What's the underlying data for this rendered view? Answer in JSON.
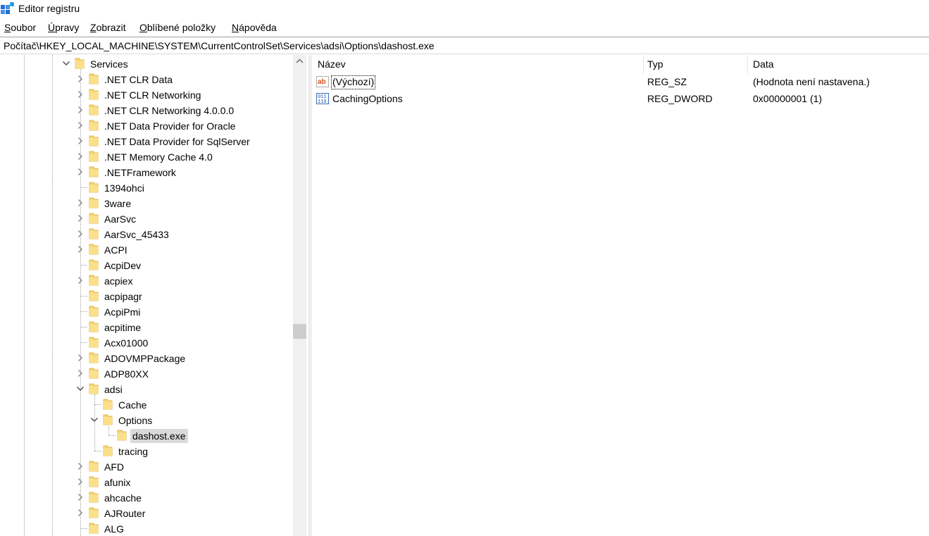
{
  "window": {
    "title": "Editor registru",
    "icon": "registry-editor-icon"
  },
  "menu": [
    {
      "pre": "",
      "u": "S",
      "post": "oubor"
    },
    {
      "pre": "",
      "u": "Ú",
      "post": "pravy"
    },
    {
      "pre": "",
      "u": "Z",
      "post": "obrazit"
    },
    {
      "pre": "",
      "u": "O",
      "post": "blíbené položky"
    },
    {
      "pre": "",
      "u": "N",
      "post": "ápověda"
    }
  ],
  "address": "Počítač\\HKEY_LOCAL_MACHINE\\SYSTEM\\CurrentControlSet\\Services\\adsi\\Options\\dashost.exe",
  "tree": [
    {
      "label": "Services",
      "level": 0,
      "toggle": "expanded"
    },
    {
      "label": ".NET CLR Data",
      "level": 1,
      "toggle": "collapsed"
    },
    {
      "label": ".NET CLR Networking",
      "level": 1,
      "toggle": "collapsed"
    },
    {
      "label": ".NET CLR Networking 4.0.0.0",
      "level": 1,
      "toggle": "collapsed"
    },
    {
      "label": ".NET Data Provider for Oracle",
      "level": 1,
      "toggle": "collapsed"
    },
    {
      "label": ".NET Data Provider for SqlServer",
      "level": 1,
      "toggle": "collapsed"
    },
    {
      "label": ".NET Memory Cache 4.0",
      "level": 1,
      "toggle": "collapsed"
    },
    {
      "label": ".NETFramework",
      "level": 1,
      "toggle": "collapsed"
    },
    {
      "label": "1394ohci",
      "level": 1,
      "toggle": "none"
    },
    {
      "label": "3ware",
      "level": 1,
      "toggle": "collapsed"
    },
    {
      "label": "AarSvc",
      "level": 1,
      "toggle": "collapsed"
    },
    {
      "label": "AarSvc_45433",
      "level": 1,
      "toggle": "collapsed"
    },
    {
      "label": "ACPI",
      "level": 1,
      "toggle": "collapsed"
    },
    {
      "label": "AcpiDev",
      "level": 1,
      "toggle": "none"
    },
    {
      "label": "acpiex",
      "level": 1,
      "toggle": "collapsed"
    },
    {
      "label": "acpipagr",
      "level": 1,
      "toggle": "none"
    },
    {
      "label": "AcpiPmi",
      "level": 1,
      "toggle": "none"
    },
    {
      "label": "acpitime",
      "level": 1,
      "toggle": "none"
    },
    {
      "label": "Acx01000",
      "level": 1,
      "toggle": "none"
    },
    {
      "label": "ADOVMPPackage",
      "level": 1,
      "toggle": "collapsed"
    },
    {
      "label": "ADP80XX",
      "level": 1,
      "toggle": "collapsed"
    },
    {
      "label": "adsi",
      "level": 1,
      "toggle": "expanded"
    },
    {
      "label": "Cache",
      "level": 2,
      "toggle": "none"
    },
    {
      "label": "Options",
      "level": 2,
      "toggle": "expanded"
    },
    {
      "label": "dashost.exe",
      "level": 3,
      "toggle": "none",
      "selected": true
    },
    {
      "label": "tracing",
      "level": 2,
      "toggle": "none"
    },
    {
      "label": "AFD",
      "level": 1,
      "toggle": "collapsed"
    },
    {
      "label": "afunix",
      "level": 1,
      "toggle": "collapsed"
    },
    {
      "label": "ahcache",
      "level": 1,
      "toggle": "collapsed"
    },
    {
      "label": "AJRouter",
      "level": 1,
      "toggle": "collapsed"
    },
    {
      "label": "ALG",
      "level": 1,
      "toggle": "none"
    }
  ],
  "list": {
    "columns": [
      "Název",
      "Typ",
      "Data"
    ],
    "rows": [
      {
        "name": "(Výchozí)",
        "type": "REG_SZ",
        "data": "(Hodnota není nastavena.)",
        "icon": "string-value-icon"
      },
      {
        "name": "CachingOptions",
        "type": "REG_DWORD",
        "data": "0x00000001 (1)",
        "icon": "binary-value-icon"
      }
    ]
  }
}
